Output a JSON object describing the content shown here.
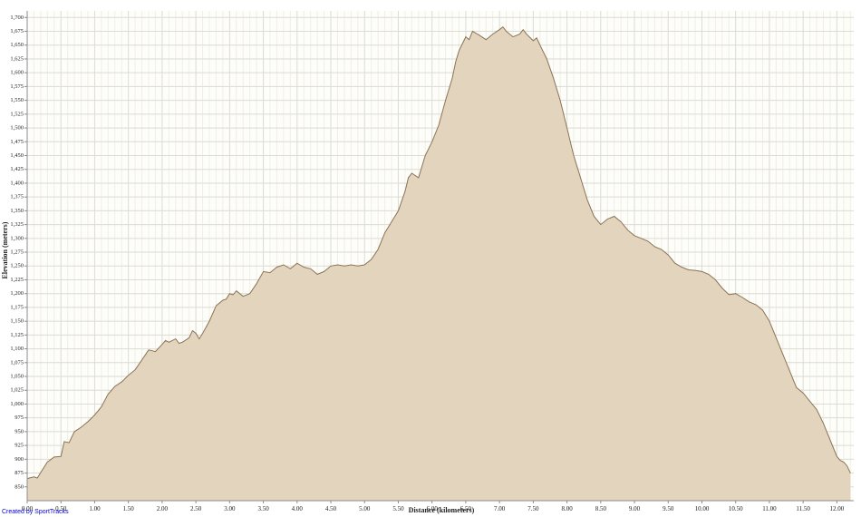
{
  "chart_data": {
    "type": "area",
    "title": "",
    "xlabel": "Distance (kilometers)",
    "ylabel": "Elevation (meters)",
    "xlim": [
      0,
      12.25
    ],
    "ylim": [
      825,
      1712
    ],
    "grid": true,
    "x_ticks": [
      0,
      0.5,
      1,
      1.5,
      2,
      2.5,
      3,
      3.5,
      4,
      4.5,
      5,
      5.5,
      6,
      6.5,
      7,
      7.5,
      8,
      8.5,
      9,
      9.5,
      10,
      10.5,
      11,
      11.5,
      12
    ],
    "x_tick_labels": [
      "0.00",
      "0.50",
      "1.00",
      "1.50",
      "2.00",
      "2.50",
      "3.00",
      "3.50",
      "4.00",
      "4.50",
      "5.00",
      "5.50",
      "6.00",
      "6.50",
      "7.00",
      "7.50",
      "8.00",
      "8.50",
      "9.00",
      "9.50",
      "10.00",
      "10.50",
      "11.00",
      "11.50",
      "12.00"
    ],
    "y_ticks": [
      850,
      875,
      900,
      925,
      950,
      975,
      1000,
      1025,
      1050,
      1075,
      1100,
      1125,
      1150,
      1175,
      1200,
      1225,
      1250,
      1275,
      1300,
      1325,
      1350,
      1375,
      1400,
      1425,
      1450,
      1475,
      1500,
      1525,
      1550,
      1575,
      1600,
      1625,
      1650,
      1675,
      1700
    ],
    "y_tick_labels": [
      "850",
      "875",
      "900",
      "925",
      "950",
      "975",
      "1,000",
      "1,025",
      "1,050",
      "1,075",
      "1,100",
      "1,125",
      "1,150",
      "1,175",
      "1,200",
      "1,225",
      "1,250",
      "1,275",
      "1,300",
      "1,325",
      "1,350",
      "1,375",
      "1,400",
      "1,425",
      "1,450",
      "1,475",
      "1,500",
      "1,525",
      "1,550",
      "1,575",
      "1,600",
      "1,625",
      "1,650",
      "1,675",
      "1,700"
    ],
    "series": [
      {
        "x": [
          0.0,
          0.1,
          0.15,
          0.2,
          0.3,
          0.4,
          0.5,
          0.55,
          0.62,
          0.7,
          0.8,
          0.9,
          1.0,
          1.1,
          1.2,
          1.3,
          1.4,
          1.5,
          1.6,
          1.7,
          1.8,
          1.9,
          2.0,
          2.05,
          2.1,
          2.2,
          2.25,
          2.3,
          2.4,
          2.45,
          2.5,
          2.55,
          2.6,
          2.7,
          2.8,
          2.9,
          2.95,
          3.0,
          3.05,
          3.1,
          3.2,
          3.3,
          3.4,
          3.5,
          3.6,
          3.7,
          3.8,
          3.9,
          4.0,
          4.1,
          4.2,
          4.3,
          4.4,
          4.5,
          4.6,
          4.7,
          4.8,
          4.9,
          5.0,
          5.1,
          5.2,
          5.3,
          5.4,
          5.5,
          5.6,
          5.65,
          5.7,
          5.8,
          5.9,
          6.0,
          6.1,
          6.2,
          6.3,
          6.35,
          6.4,
          6.5,
          6.55,
          6.6,
          6.7,
          6.8,
          6.9,
          7.0,
          7.05,
          7.1,
          7.2,
          7.3,
          7.35,
          7.4,
          7.5,
          7.55,
          7.6,
          7.7,
          7.8,
          7.9,
          8.0,
          8.1,
          8.2,
          8.3,
          8.4,
          8.5,
          8.6,
          8.7,
          8.8,
          8.9,
          9.0,
          9.1,
          9.2,
          9.3,
          9.4,
          9.5,
          9.6,
          9.7,
          9.8,
          9.9,
          10.0,
          10.1,
          10.2,
          10.3,
          10.4,
          10.5,
          10.6,
          10.7,
          10.8,
          10.9,
          11.0,
          11.1,
          11.2,
          11.3,
          11.4,
          11.5,
          11.6,
          11.7,
          11.8,
          11.9,
          12.0,
          12.05,
          12.1,
          12.15,
          12.2
        ],
        "y": [
          865,
          868,
          866,
          876,
          895,
          904,
          905,
          932,
          930,
          950,
          958,
          968,
          980,
          995,
          1018,
          1032,
          1040,
          1052,
          1062,
          1080,
          1098,
          1095,
          1108,
          1115,
          1112,
          1118,
          1110,
          1112,
          1120,
          1133,
          1128,
          1118,
          1128,
          1150,
          1178,
          1188,
          1190,
          1200,
          1198,
          1205,
          1195,
          1200,
          1218,
          1240,
          1238,
          1248,
          1252,
          1245,
          1255,
          1248,
          1245,
          1235,
          1240,
          1250,
          1252,
          1250,
          1252,
          1250,
          1252,
          1262,
          1280,
          1310,
          1330,
          1350,
          1385,
          1410,
          1418,
          1410,
          1450,
          1475,
          1505,
          1550,
          1590,
          1620,
          1640,
          1665,
          1660,
          1675,
          1668,
          1660,
          1670,
          1678,
          1683,
          1675,
          1665,
          1670,
          1678,
          1670,
          1658,
          1663,
          1650,
          1625,
          1590,
          1550,
          1500,
          1450,
          1410,
          1370,
          1340,
          1325,
          1335,
          1340,
          1330,
          1315,
          1305,
          1300,
          1295,
          1285,
          1280,
          1270,
          1255,
          1248,
          1243,
          1242,
          1240,
          1235,
          1225,
          1210,
          1198,
          1200,
          1193,
          1185,
          1180,
          1170,
          1150,
          1120,
          1090,
          1060,
          1030,
          1020,
          1005,
          990,
          965,
          935,
          905,
          898,
          895,
          888,
          875
        ]
      }
    ]
  },
  "credit": {
    "label": "Created by SportTracks"
  }
}
